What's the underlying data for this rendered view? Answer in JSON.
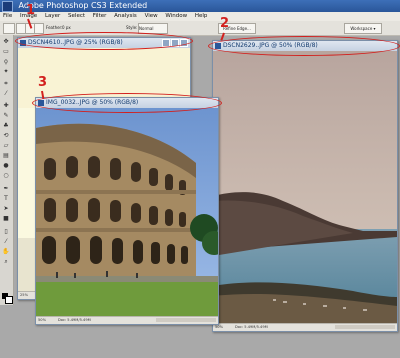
{
  "app": {
    "title": "Adobe Photoshop CS3 Extended"
  },
  "menu": [
    "File",
    "Image",
    "Layer",
    "Select",
    "Filter",
    "Analysis",
    "View",
    "Window",
    "Help"
  ],
  "options_bar": {
    "feather_label": "Feather:",
    "feather_value": "0 px",
    "style_label": "Style:",
    "style_value": "Normal",
    "refine_edge": "Refine Edge...",
    "workspace": "Workspace ▾"
  },
  "documents": [
    {
      "title": "DSCN4610..JPG @ 25% (RGB/8)",
      "zoom": "25%",
      "info": "Doc: 5.49M/5.49M"
    },
    {
      "title": "DSCN2629..JPG @ 50% (RGB/8)",
      "zoom": "50%",
      "info": "Doc: 5.49M/5.49M"
    },
    {
      "title": "IMG_0032..JPG @ 50% (RGB/8)",
      "zoom": "50%",
      "info": "Doc: 5.49M/5.49M"
    }
  ],
  "annotations": [
    "1",
    "2",
    "3"
  ],
  "colors": {
    "annotation": "#d2201e",
    "titlebar": "#2a5699"
  }
}
